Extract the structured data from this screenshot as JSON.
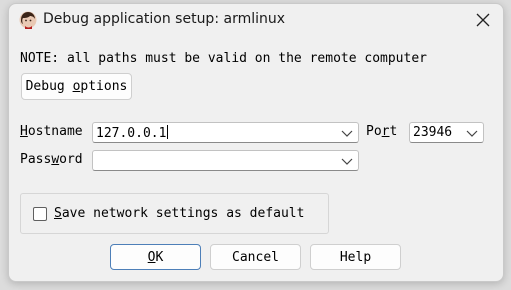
{
  "window": {
    "title": "Debug application setup: armlinux",
    "icon": "ida-app-icon",
    "close_icon": "close-icon"
  },
  "note_text": "NOTE: all paths must be valid on the remote computer",
  "debug_options_button": {
    "before": "Debug ",
    "mnemonic": "o",
    "after": "ptions"
  },
  "hostname": {
    "label_mnemonic": "H",
    "label_rest": "ostname",
    "value": "127.0.0.1"
  },
  "port": {
    "label_before": "Po",
    "label_mnemonic": "r",
    "label_after": "t",
    "value": "23946"
  },
  "password": {
    "label_before": "Pass",
    "label_mnemonic": "w",
    "label_after": "ord",
    "value": ""
  },
  "save_settings": {
    "mnemonic": "S",
    "label_rest": "ave network settings as default",
    "checked": false
  },
  "buttons": {
    "ok_mnemonic": "O",
    "ok_rest": "K",
    "cancel": "Cancel",
    "help": "Help"
  }
}
